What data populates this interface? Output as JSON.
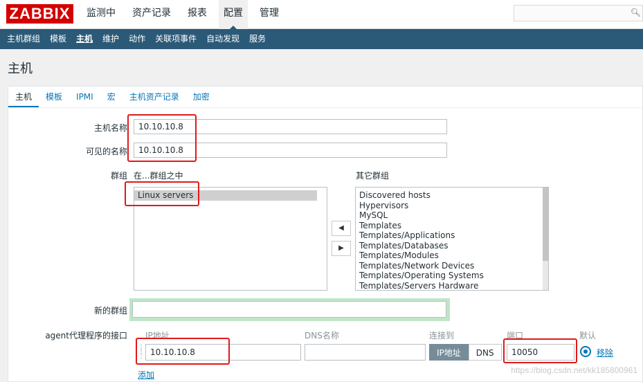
{
  "brand": "ZABBIX",
  "top_nav": [
    "监测中",
    "资产记录",
    "报表",
    "配置",
    "管理"
  ],
  "top_nav_active": "配置",
  "search": {
    "value": "",
    "icon": "search-icon"
  },
  "sub_nav": [
    "主机群组",
    "模板",
    "主机",
    "维护",
    "动作",
    "关联项事件",
    "自动发现",
    "服务"
  ],
  "sub_nav_active": "主机",
  "page_title": "主机",
  "tabs": [
    "主机",
    "模板",
    "IPMI",
    "宏",
    "主机资产记录",
    "加密"
  ],
  "form": {
    "host_name_label": "主机名称",
    "host_name_value": "10.10.10.8",
    "visible_name_label": "可见的名称",
    "visible_name_value": "10.10.10.8",
    "groups_label": "群组",
    "in_groups_label": "在...群组之中",
    "other_groups_label": "其它群组",
    "in_groups": [
      "Linux servers"
    ],
    "other_groups": [
      "Discovered hosts",
      "Hypervisors",
      "MySQL",
      "Templates",
      "Templates/Applications",
      "Templates/Databases",
      "Templates/Modules",
      "Templates/Network Devices",
      "Templates/Operating Systems",
      "Templates/Servers Hardware"
    ],
    "move_left": "◀",
    "move_right": "▶",
    "new_group_label": "新的群组",
    "new_group_value": "",
    "agent_interface_label": "agent代理程序的接口",
    "interface_headers": {
      "ip": "IP地址",
      "dns": "DNS名称",
      "connect": "连接到",
      "port": "端口",
      "default": "默认"
    },
    "interface": {
      "ip": "10.10.10.8",
      "dns": "",
      "connect_ip": "IP地址",
      "connect_dns": "DNS",
      "connect_selected": "IP地址",
      "port": "10050",
      "remove": "移除"
    },
    "add_link": "添加"
  },
  "watermark": "https://blog.csdn.net/kk185800961",
  "colors": {
    "brand_red": "#d40000",
    "subnav_bg": "#2b5a78",
    "link": "#0275b8",
    "highlight_box": "#e01919"
  }
}
